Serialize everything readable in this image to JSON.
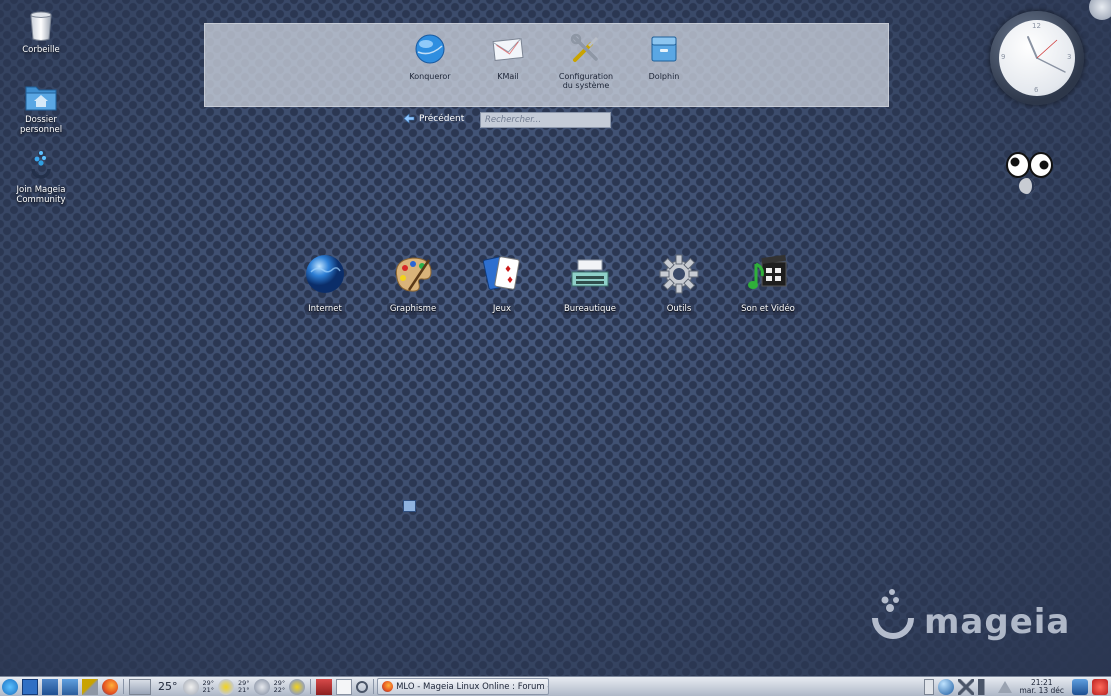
{
  "desktop": {
    "icons": [
      {
        "label": "Corbeille"
      },
      {
        "label": "Dossier\npersonnel"
      },
      {
        "label": "Join Mageia\nCommunity"
      }
    ]
  },
  "launcher": {
    "favorites": [
      {
        "label": "Konqueror"
      },
      {
        "label": "KMail"
      },
      {
        "label": "Configuration\ndu système"
      },
      {
        "label": "Dolphin"
      }
    ],
    "back_label": "Précédent",
    "search_placeholder": "Rechercher...",
    "categories": [
      {
        "label": "Internet"
      },
      {
        "label": "Graphisme"
      },
      {
        "label": "Jeux"
      },
      {
        "label": "Bureautique"
      },
      {
        "label": "Outils"
      },
      {
        "label": "Son et Vidéo"
      }
    ]
  },
  "clock_widget": {
    "numerals": {
      "n12": "12",
      "n3": "3",
      "n6": "6",
      "n9": "9"
    }
  },
  "brand": {
    "logo_text": "mageia"
  },
  "taskbar": {
    "weather": {
      "current": "25°",
      "day1_high": "29°",
      "day1_low": "21°",
      "day2_high": "29°",
      "day2_low": "21°",
      "day3_high": "29°",
      "day3_low": "22°"
    },
    "task_title": "MLO - Mageia Linux Online : Forum - M",
    "clock_time": "21:21",
    "clock_date": "mar. 13 déc"
  },
  "colors": {
    "desktop_bg": "#3a4a69",
    "panel_bg": "#d6dbe4",
    "taskbar_bg": "#c9d0dc",
    "mageia_blue": "#2f9fe0"
  }
}
